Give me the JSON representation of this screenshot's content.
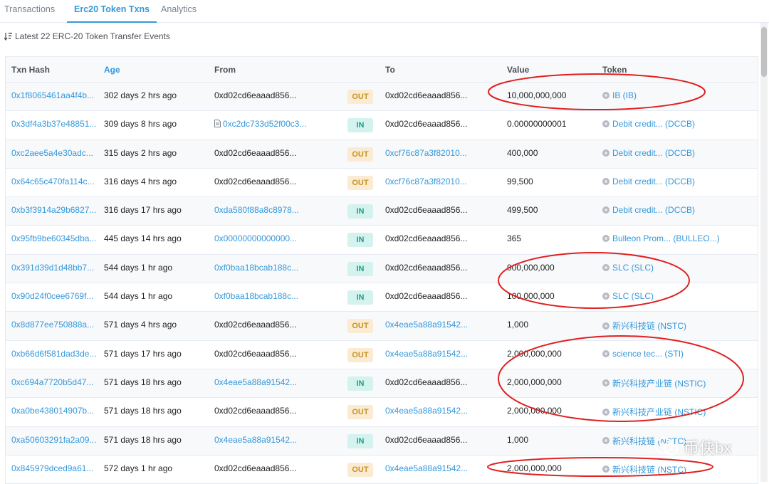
{
  "tabs": [
    {
      "label": "Transactions"
    },
    {
      "label": "Erc20 Token Txns"
    },
    {
      "label": "Analytics"
    }
  ],
  "summary": "Latest 22 ERC-20 Token Transfer Events",
  "columns": {
    "hash": "Txn Hash",
    "age": "Age",
    "from": "From",
    "to": "To",
    "value": "Value",
    "token": "Token"
  },
  "rows": [
    {
      "hash": "0x1f8065461aa4f4b...",
      "age": "302 days 2 hrs ago",
      "from": "0xd02cd6eaaad856...",
      "direction": "OUT",
      "to": "0xd02cd6eaaad856...",
      "value": "10,000,000,000",
      "token": "IB (IB)"
    },
    {
      "hash": "0x3df4a3b37e48851...",
      "age": "309 days 8 hrs ago",
      "from": "0xc2dc733d52f00c3...",
      "direction": "IN",
      "to": "0xd02cd6eaaad856...",
      "value": "0.00000000001",
      "token": "Debit credit... (DCCB)"
    },
    {
      "hash": "0xc2aee5a4e30adc...",
      "age": "315 days 2 hrs ago",
      "from": "0xd02cd6eaaad856...",
      "direction": "OUT",
      "to": "0xcf76c87a3f82010...",
      "value": "400,000",
      "token": "Debit credit... (DCCB)"
    },
    {
      "hash": "0x64c65c470fa114c...",
      "age": "316 days 4 hrs ago",
      "from": "0xd02cd6eaaad856...",
      "direction": "OUT",
      "to": "0xcf76c87a3f82010...",
      "value": "99,500",
      "token": "Debit credit... (DCCB)"
    },
    {
      "hash": "0xb3f3914a29b6827...",
      "age": "316 days 17 hrs ago",
      "from": "0xda580f88a8c8978...",
      "direction": "IN",
      "to": "0xd02cd6eaaad856...",
      "value": "499,500",
      "token": "Debit credit... (DCCB)"
    },
    {
      "hash": "0x95fb9be60345dba...",
      "age": "445 days 14 hrs ago",
      "from": "0x00000000000000...",
      "direction": "IN",
      "to": "0xd02cd6eaaad856...",
      "value": "365",
      "token": "Bulleon Prom... (BULLEO...)"
    },
    {
      "hash": "0x391d39d1d48bb7...",
      "age": "544 days 1 hr ago",
      "from": "0xf0baa18bcab188c...",
      "direction": "IN",
      "to": "0xd02cd6eaaad856...",
      "value": "900,000,000",
      "token": "SLC (SLC)"
    },
    {
      "hash": "0x90d24f0cee6769f...",
      "age": "544 days 1 hr ago",
      "from": "0xf0baa18bcab188c...",
      "direction": "IN",
      "to": "0xd02cd6eaaad856...",
      "value": "100,000,000",
      "token": "SLC (SLC)"
    },
    {
      "hash": "0x8d877ee750888a...",
      "age": "571 days 4 hrs ago",
      "from": "0xd02cd6eaaad856...",
      "direction": "OUT",
      "to": "0x4eae5a88a91542...",
      "value": "1,000",
      "token": "新兴科技链 (NSTC)"
    },
    {
      "hash": "0xb66d6f581dad3de...",
      "age": "571 days 17 hrs ago",
      "from": "0xd02cd6eaaad856...",
      "direction": "OUT",
      "to": "0x4eae5a88a91542...",
      "value": "2,000,000,000",
      "token": "science tec... (STI)"
    },
    {
      "hash": "0xc694a7720b5d47...",
      "age": "571 days 18 hrs ago",
      "from": "0x4eae5a88a91542...",
      "direction": "IN",
      "to": "0xd02cd6eaaad856...",
      "value": "2,000,000,000",
      "token": "新兴科技产业链 (NSTIC)"
    },
    {
      "hash": "0xa0be438014907b...",
      "age": "571 days 18 hrs ago",
      "from": "0xd02cd6eaaad856...",
      "direction": "OUT",
      "to": "0x4eae5a88a91542...",
      "value": "2,000,000,000",
      "token": "新兴科技产业链 (NSTIC)"
    },
    {
      "hash": "0xa50603291fa2a09...",
      "age": "571 days 18 hrs ago",
      "from": "0x4eae5a88a91542...",
      "direction": "IN",
      "to": "0xd02cd6eaaad856...",
      "value": "1,000",
      "token": "新兴科技链 (NSTC)"
    },
    {
      "hash": "0x845979dced9a61...",
      "age": "572 days 1 hr ago",
      "from": "0xd02cd6eaaad856...",
      "direction": "OUT",
      "to": "0x4eae5a88a91542...",
      "value": "2,000,000,000",
      "token": "新兴科技链 (NSTC)"
    }
  ],
  "watermark": "币侠bx",
  "colors": {
    "link": "#3498db",
    "out_badge_bg": "#fbebd2",
    "in_badge_bg": "#d4f2ee",
    "annotation": "#e02020"
  }
}
